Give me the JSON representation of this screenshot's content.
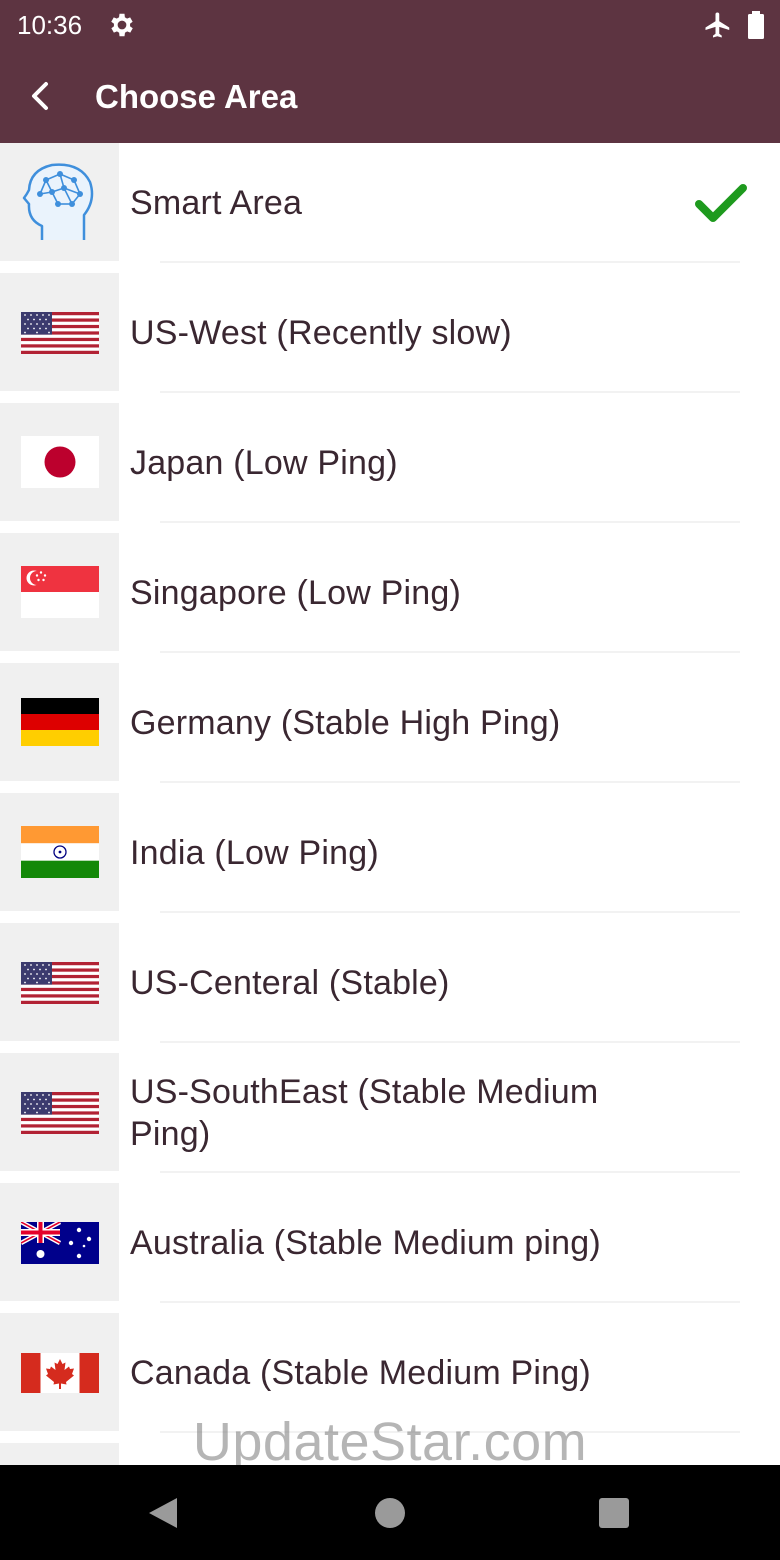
{
  "status_bar": {
    "time": "10:36",
    "icons": [
      "gear-icon",
      "airplane-icon",
      "battery-icon"
    ]
  },
  "app_bar": {
    "title": "Choose Area",
    "back_icon": "back-arrow-icon",
    "background": "#5d3441"
  },
  "areas": [
    {
      "label": "Smart Area",
      "icon": "brain-head-icon",
      "selected": true
    },
    {
      "label": "US-West (Recently slow)",
      "icon": "us-flag-icon"
    },
    {
      "label": "Japan (Low Ping)",
      "icon": "japan-flag-icon"
    },
    {
      "label": "Singapore (Low Ping)",
      "icon": "singapore-flag-icon"
    },
    {
      "label": "Germany (Stable High Ping)",
      "icon": "germany-flag-icon"
    },
    {
      "label": "India (Low Ping)",
      "icon": "india-flag-icon"
    },
    {
      "label": "US-Centeral (Stable)",
      "icon": "us-flag-icon"
    },
    {
      "label": "US-SouthEast (Stable Medium Ping)",
      "icon": "us-flag-icon"
    },
    {
      "label": "Australia (Stable Medium ping)",
      "icon": "australia-flag-icon"
    },
    {
      "label": "Canada (Stable Medium Ping)",
      "icon": "canada-flag-icon"
    }
  ],
  "selected_indicator": {
    "icon": "checkmark-icon",
    "color": "#1e9a1e"
  },
  "watermark": "UpdateStar.com",
  "nav_bar": {
    "icons": [
      "nav-back-icon",
      "nav-home-icon",
      "nav-recents-icon"
    ]
  }
}
